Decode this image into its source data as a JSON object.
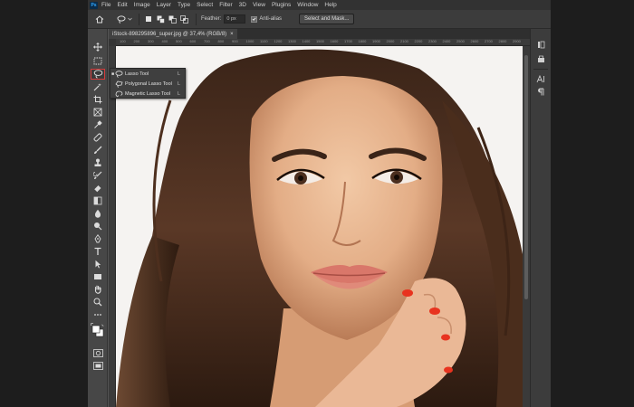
{
  "menu": {
    "logo": "Ps",
    "items": [
      "File",
      "Edit",
      "Image",
      "Layer",
      "Type",
      "Select",
      "Filter",
      "3D",
      "View",
      "Plugins",
      "Window",
      "Help"
    ]
  },
  "options": {
    "feather_label": "Feather:",
    "feather_value": "0 px",
    "antialias_label": "Anti-alias",
    "antialias_checked": true,
    "select_mask_label": "Select and Mask..."
  },
  "document": {
    "tab_title": "iStock-898295896_super.jpg @ 37,4% (RGB/8)",
    "close_glyph": "×",
    "ruler_marks": [
      "100",
      "200",
      "300",
      "400",
      "500",
      "600",
      "700",
      "800",
      "900",
      "1000",
      "1100",
      "1200",
      "1300",
      "1400",
      "1500",
      "1600",
      "1700",
      "1800",
      "1900",
      "2000",
      "2100",
      "2200",
      "2300",
      "2400",
      "2500",
      "2600",
      "2700",
      "2800",
      "2900"
    ]
  },
  "flyout": {
    "items": [
      {
        "label": "Lasso Tool",
        "key": "L",
        "selected": true
      },
      {
        "label": "Polygonal Lasso Tool",
        "key": "L",
        "selected": false
      },
      {
        "label": "Magnetic Lasso Tool",
        "key": "L",
        "selected": false
      }
    ]
  },
  "colors": {
    "accent_selected": "#d43c3c",
    "app_bg": "#535353"
  }
}
